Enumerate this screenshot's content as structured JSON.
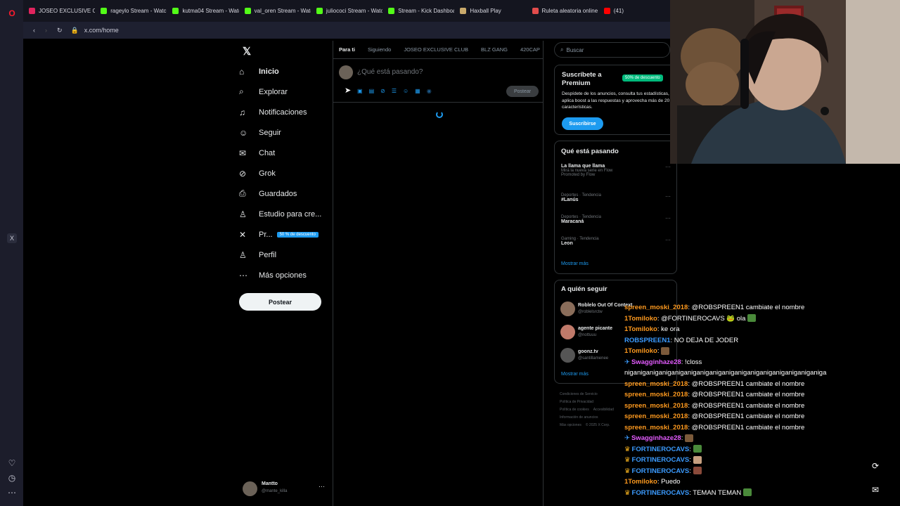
{
  "browser": {
    "tabs": [
      {
        "label": "JOSEO EXCLUSIVE CLUB",
        "icon": "opera-record-icon",
        "color": "#e0245e"
      },
      {
        "label": "rageylo Stream - Watch L",
        "icon": "kick-icon",
        "color": "#53fc18"
      },
      {
        "label": "kutma04 Stream - Watch",
        "icon": "kick-icon",
        "color": "#53fc18"
      },
      {
        "label": "val_oren Stream - Watch",
        "icon": "kick-icon",
        "color": "#53fc18"
      },
      {
        "label": "juliococi Stream - Watch",
        "icon": "kick-icon",
        "color": "#53fc18"
      },
      {
        "label": "Stream - Kick Dashboard",
        "icon": "kick-icon",
        "color": "#53fc18"
      },
      {
        "label": "Haxball Play",
        "icon": "haxball-icon",
        "color": "#c9a96b"
      },
      {
        "label": "Ruleta aleatoria online - r",
        "icon": "wheel-icon",
        "color": "#e24c4c"
      },
      {
        "label": "(41)",
        "icon": "youtube-icon",
        "color": "#ff0000"
      }
    ],
    "url": "x.com/home"
  },
  "nav": {
    "items": [
      {
        "label": "Inicio",
        "icon": "home-icon",
        "glyph": "⌂"
      },
      {
        "label": "Explorar",
        "icon": "search-icon",
        "glyph": "⌕"
      },
      {
        "label": "Notificaciones",
        "icon": "bell-icon",
        "glyph": "♫"
      },
      {
        "label": "Seguir",
        "icon": "person-add-icon",
        "glyph": "☺"
      },
      {
        "label": "Chat",
        "icon": "mail-icon",
        "glyph": "✉"
      },
      {
        "label": "Grok",
        "icon": "grok-icon",
        "glyph": "⊘"
      },
      {
        "label": "Guardados",
        "icon": "bookmark-icon",
        "glyph": "⎙"
      },
      {
        "label": "Estudio para cre...",
        "icon": "creator-icon",
        "glyph": "♙"
      },
      {
        "label": "Pr...",
        "icon": "x-premium-icon",
        "glyph": "✕"
      },
      {
        "label": "Perfil",
        "icon": "profile-icon",
        "glyph": "♙"
      },
      {
        "label": "Más opciones",
        "icon": "more-options-icon",
        "glyph": "⋯"
      }
    ],
    "premium_badge": "50 % de descuento",
    "post_button": "Postear",
    "user_name": "Mantto",
    "user_handle": "@mante_killa"
  },
  "feed": {
    "tabs": [
      "Para ti",
      "Siguiendo",
      "JOSEO EXCLUSIVE CLUB",
      "BLZ GANG",
      "420CAP"
    ],
    "compose_placeholder": "¿Qué está pasando?",
    "post_button": "Postear"
  },
  "right": {
    "search_placeholder": "Buscar",
    "premium": {
      "title": "Suscríbete a Premium",
      "discount": "50% de descuento",
      "body": "Despídete de los anuncios, consulta tus estadísticas, aplica boost a las respuestas y aprovecha más de 20 características.",
      "button": "Suscribirse"
    },
    "trending": {
      "title": "Qué está pasando",
      "items": [
        {
          "title": "La llama que llama",
          "sub": "Mirá la nueva serie en Flow",
          "meta": "Promoted by Flow"
        },
        {
          "title": "#Lanús",
          "sub": "",
          "meta": "Deportes · Tendencia"
        },
        {
          "title": "Maracaná",
          "sub": "",
          "meta": "Deportes · Tendencia"
        },
        {
          "title": "Leon",
          "sub": "",
          "meta": "Gaming · Tendencia"
        }
      ],
      "more": "Mostrar más"
    },
    "follow": {
      "title": "A quién seguir",
      "items": [
        {
          "name": "Roblelo Out Of Context",
          "handle": "@roblelsrctw"
        },
        {
          "name": "agente picante",
          "handle": "@nottuuu"
        },
        {
          "name": "goonz.tv",
          "handle": "@santillamenee"
        }
      ],
      "more": "Mostrar más"
    },
    "footer": [
      "Condiciones de Servicio",
      "Política de Privacidad",
      "Política de cookies",
      "Accesibilidad",
      "Información de anuncios",
      "Más opciones",
      "© 2025 X Corp."
    ]
  },
  "chat": [
    {
      "user": "spreen_moski_2018",
      "color": "orange",
      "prefix": "",
      "text": ": @ROBSPREEN1 cambiate el nombre"
    },
    {
      "user": "1Tomiloko",
      "color": "orange",
      "prefix": "",
      "text": ": @FORTINEROCAVS 🐸 ola"
    },
    {
      "user": "1Tomiloko",
      "color": "orange",
      "prefix": "",
      "text": ": ke ora"
    },
    {
      "user": "ROBSPREEN1",
      "color": "blue",
      "prefix": "",
      "text": ": NO DEJA DE JODER"
    },
    {
      "user": "1Tomiloko",
      "color": "orange",
      "prefix": "",
      "text": ":"
    },
    {
      "user": "Swagginhaze28",
      "color": "pink",
      "prefix": "✈",
      "text": ": !closs"
    },
    {
      "user": "",
      "color": "",
      "prefix": "",
      "text": "niganiganiganiganiganiganiganiganiganiganiganiganiganiganiganiga"
    },
    {
      "user": "spreen_moski_2018",
      "color": "orange",
      "prefix": "",
      "text": ": @ROBSPREEN1 cambiate el nombre"
    },
    {
      "user": "spreen_moski_2018",
      "color": "orange",
      "prefix": "",
      "text": ": @ROBSPREEN1 cambiate el nombre"
    },
    {
      "user": "spreen_moski_2018",
      "color": "orange",
      "prefix": "",
      "text": ": @ROBSPREEN1 cambiate el nombre"
    },
    {
      "user": "spreen_moski_2018",
      "color": "orange",
      "prefix": "",
      "text": ": @ROBSPREEN1 cambiate el nombre"
    },
    {
      "user": "spreen_moski_2018",
      "color": "orange",
      "prefix": "",
      "text": ": @ROBSPREEN1 cambiate el nombre"
    },
    {
      "user": "Swagginhaze28",
      "color": "pink",
      "prefix": "✈",
      "text": ":"
    },
    {
      "user": "FORTINEROCAVS",
      "color": "blue",
      "prefix": "♛",
      "text": ":"
    },
    {
      "user": "FORTINEROCAVS",
      "color": "blue",
      "prefix": "♛",
      "text": ":"
    },
    {
      "user": "FORTINEROCAVS",
      "color": "blue",
      "prefix": "♛",
      "text": ":"
    },
    {
      "user": "1Tomiloko",
      "color": "orange",
      "prefix": "",
      "text": ": Puedo"
    },
    {
      "user": "FORTINEROCAVS",
      "color": "blue",
      "prefix": "♛",
      "text": ": TEMAN TEMAN"
    }
  ]
}
